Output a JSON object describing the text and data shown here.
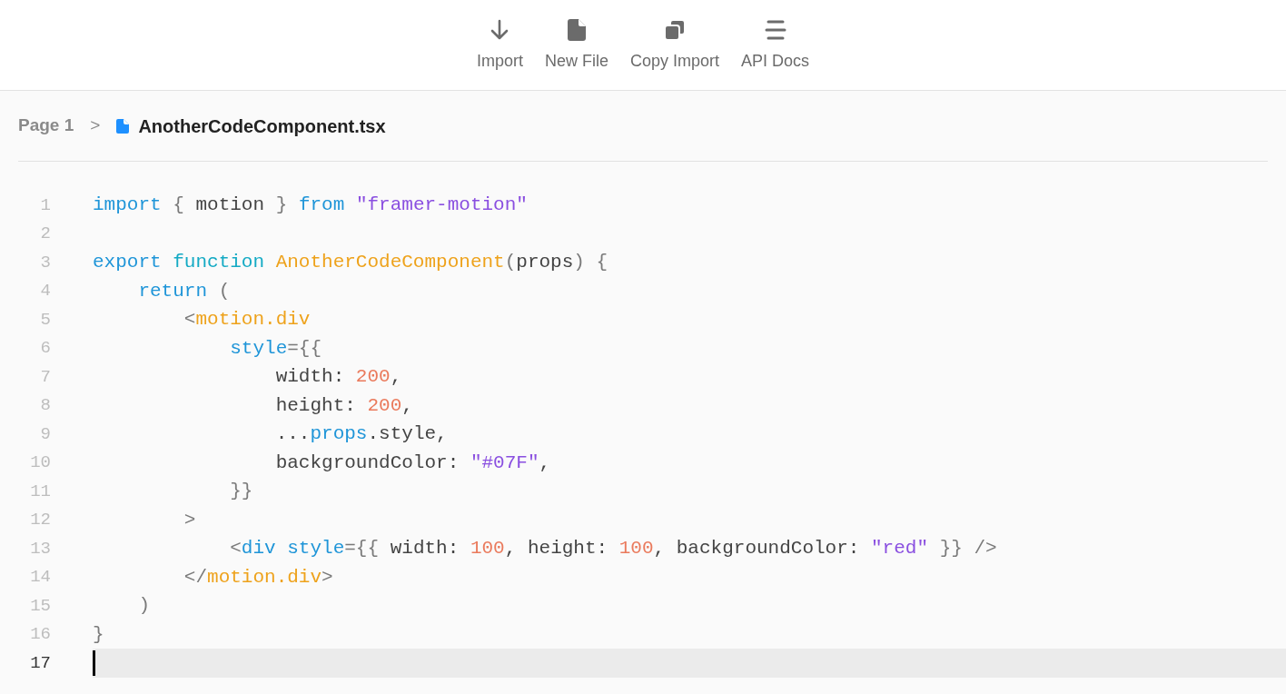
{
  "toolbar": [
    {
      "kind": "import",
      "label": "Import"
    },
    {
      "kind": "new-file",
      "label": "New File"
    },
    {
      "kind": "copy",
      "label": "Copy Import"
    },
    {
      "kind": "docs",
      "label": "API Docs"
    }
  ],
  "breadcrumb": {
    "page": "Page 1",
    "separator": ">",
    "file": "AnotherCodeComponent.tsx"
  },
  "lines": [
    {
      "number": "1",
      "current": false,
      "tokens": [
        {
          "kind": "keyword",
          "text": "import"
        },
        {
          "kind": "punct",
          "text": " { "
        },
        {
          "kind": "text",
          "text": "motion"
        },
        {
          "kind": "punct",
          "text": " } "
        },
        {
          "kind": "keyword",
          "text": "from"
        },
        {
          "kind": "string",
          "text": " \"framer-motion\""
        }
      ]
    },
    {
      "number": "2",
      "current": false
    },
    {
      "number": "3",
      "current": false,
      "tokens": [
        {
          "kind": "keyword",
          "text": "export "
        },
        {
          "kind": "keyword2",
          "text": "function "
        },
        {
          "kind": "name",
          "text": "AnotherCodeComponent"
        },
        {
          "kind": "punct",
          "text": "("
        },
        {
          "kind": "text",
          "text": "props"
        },
        {
          "kind": "punct",
          "text": ") {"
        }
      ]
    },
    {
      "number": "4",
      "current": false,
      "tokens": [
        {
          "kind": "keyword",
          "text": "    return"
        },
        {
          "kind": "punct",
          "text": " ("
        }
      ]
    },
    {
      "number": "5",
      "current": false,
      "tokens": [
        {
          "kind": "punct",
          "text": "        <"
        },
        {
          "kind": "name",
          "text": "motion.div"
        }
      ]
    },
    {
      "number": "6",
      "current": false,
      "tokens": [
        {
          "kind": "keyword",
          "text": "            style"
        },
        {
          "kind": "punct",
          "text": "={{"
        }
      ]
    },
    {
      "number": "7",
      "current": false,
      "tokens": [
        {
          "kind": "text",
          "text": "                width: "
        },
        {
          "kind": "number",
          "text": "200"
        },
        {
          "kind": "text",
          "text": ","
        }
      ]
    },
    {
      "number": "8",
      "current": false,
      "tokens": [
        {
          "kind": "text",
          "text": "                height: "
        },
        {
          "kind": "number",
          "text": "200"
        },
        {
          "kind": "text",
          "text": ","
        }
      ]
    },
    {
      "number": "9",
      "current": false,
      "tokens": [
        {
          "kind": "text",
          "text": "                ..."
        },
        {
          "kind": "keyword",
          "text": "props"
        },
        {
          "kind": "text",
          "text": ".style,"
        }
      ]
    },
    {
      "number": "10",
      "current": false,
      "tokens": [
        {
          "kind": "text",
          "text": "                backgroundColor: "
        },
        {
          "kind": "string",
          "text": "\"#07F\""
        },
        {
          "kind": "text",
          "text": ","
        }
      ]
    },
    {
      "number": "11",
      "current": false,
      "tokens": [
        {
          "kind": "punct",
          "text": "            }}"
        }
      ]
    },
    {
      "number": "12",
      "current": false,
      "tokens": [
        {
          "kind": "punct",
          "text": "        >"
        }
      ]
    },
    {
      "number": "13",
      "current": false,
      "tokens": [
        {
          "kind": "punct",
          "text": "            <"
        },
        {
          "kind": "keyword",
          "text": "div"
        },
        {
          "kind": "keyword",
          "text": " style"
        },
        {
          "kind": "punct",
          "text": "={{ "
        },
        {
          "kind": "text",
          "text": "width: "
        },
        {
          "kind": "number",
          "text": "100"
        },
        {
          "kind": "text",
          "text": ", height: "
        },
        {
          "kind": "number",
          "text": "100"
        },
        {
          "kind": "text",
          "text": ", backgroundColor: "
        },
        {
          "kind": "string",
          "text": "\"red\""
        },
        {
          "kind": "punct",
          "text": " }} />"
        }
      ]
    },
    {
      "number": "14",
      "current": false,
      "tokens": [
        {
          "kind": "punct",
          "text": "        </"
        },
        {
          "kind": "name",
          "text": "motion.div"
        },
        {
          "kind": "punct",
          "text": ">"
        }
      ]
    },
    {
      "number": "15",
      "current": false,
      "tokens": [
        {
          "kind": "punct",
          "text": "    )"
        }
      ]
    },
    {
      "number": "16",
      "current": false,
      "tokens": [
        {
          "kind": "punct",
          "text": "}"
        }
      ]
    },
    {
      "number": "17",
      "current": true
    }
  ]
}
